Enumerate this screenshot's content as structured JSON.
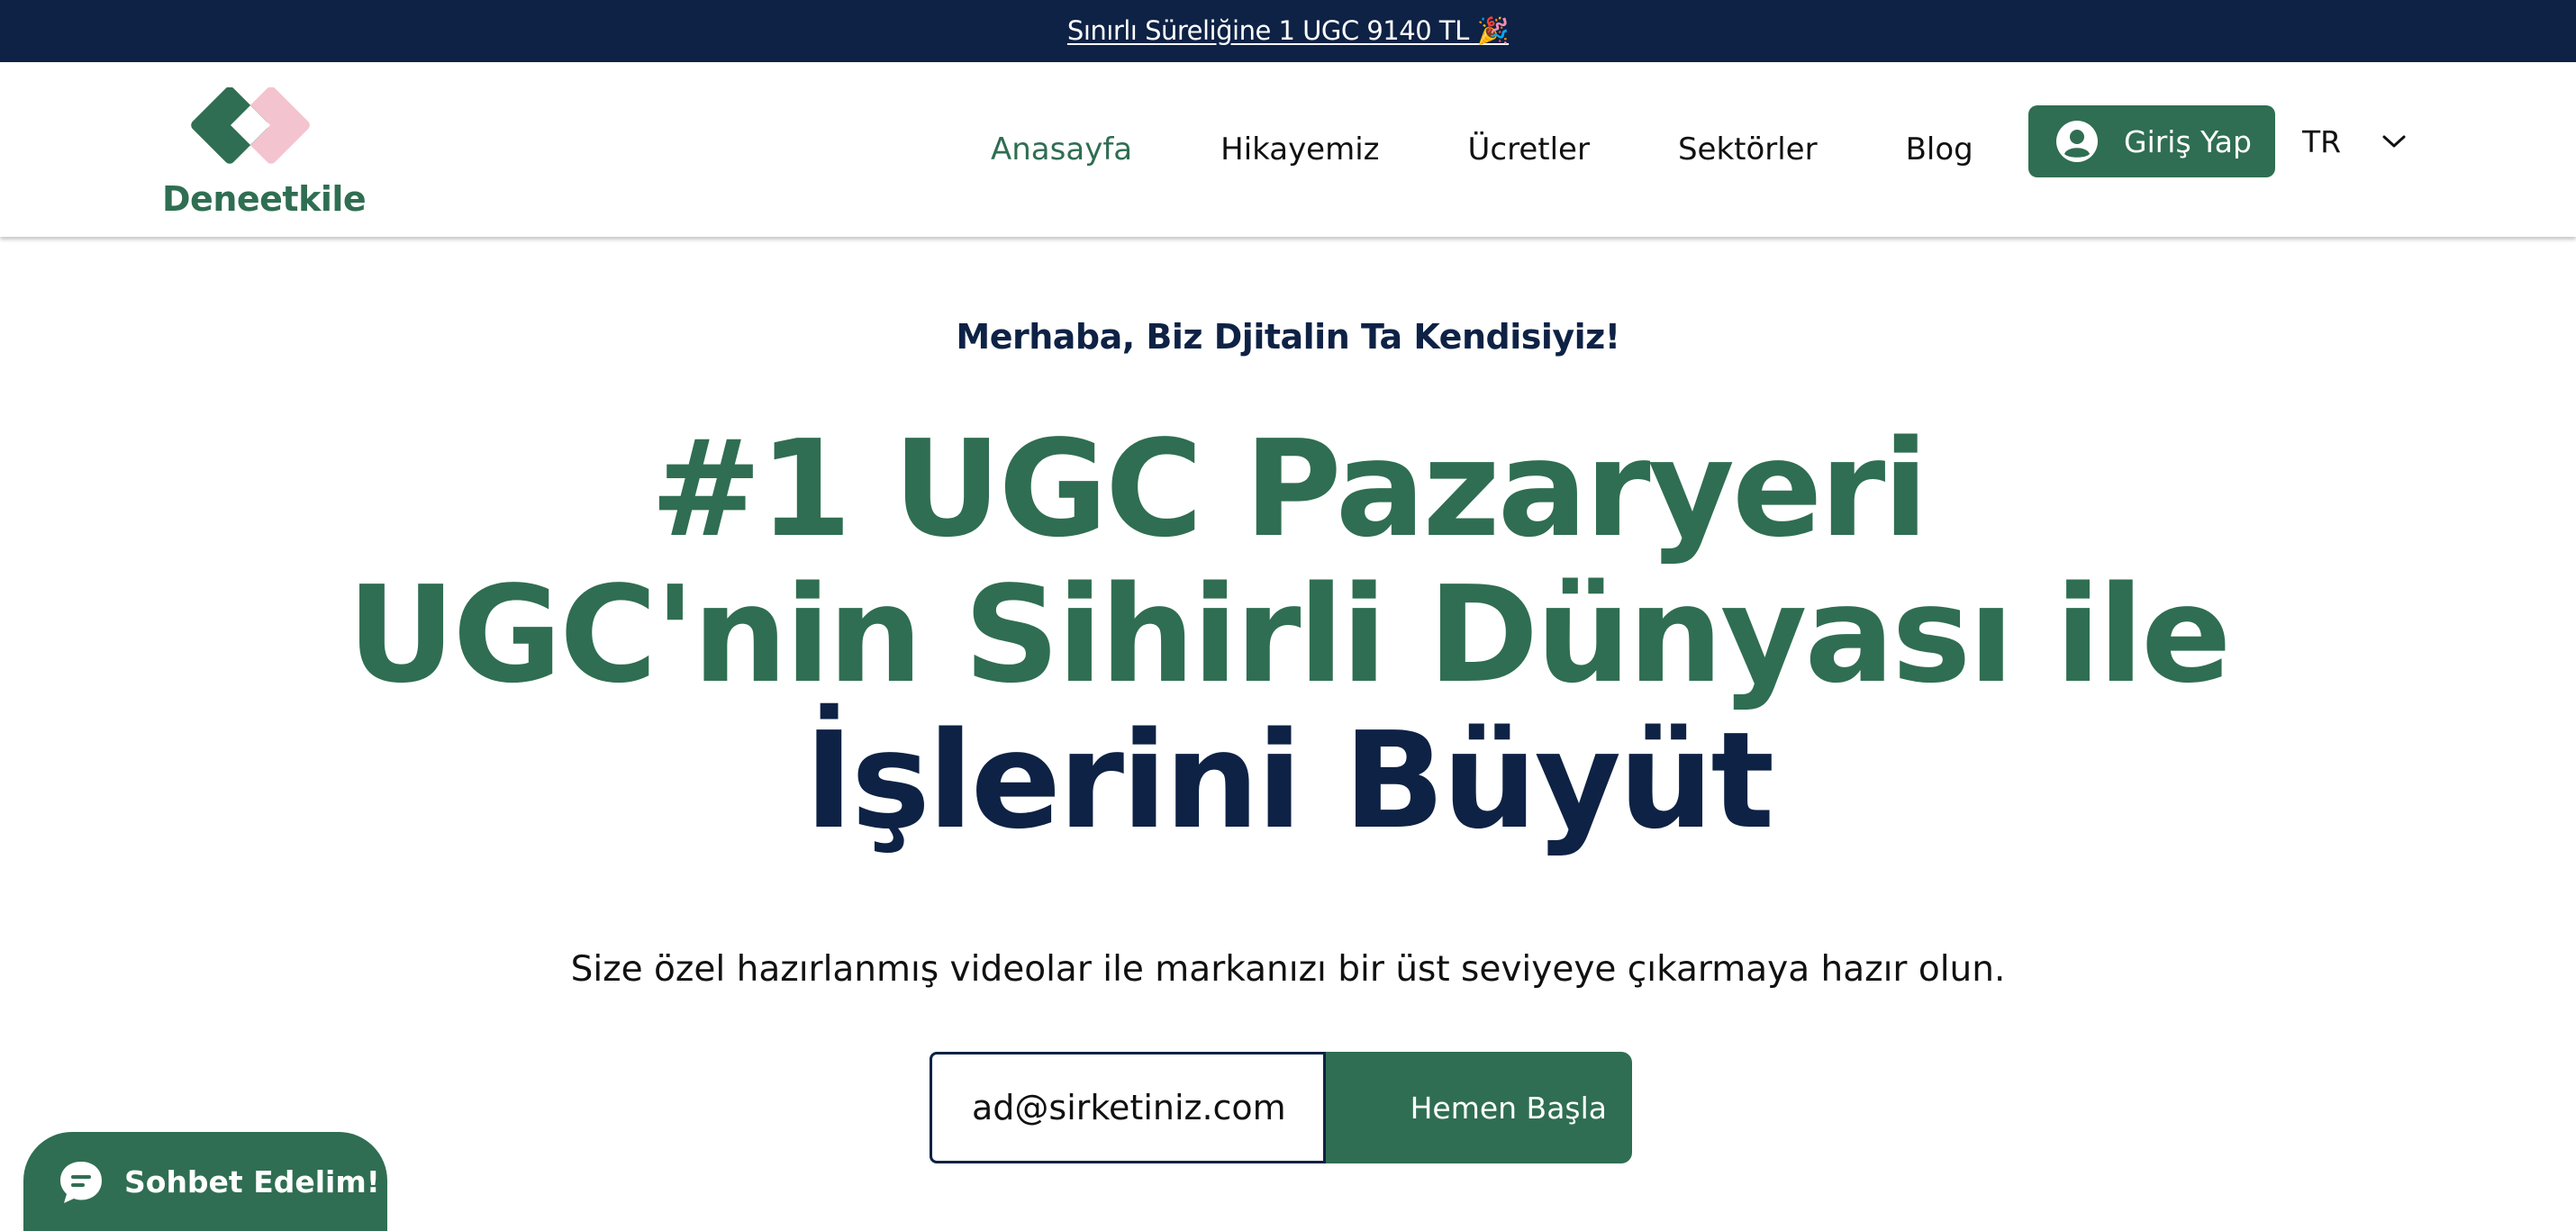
{
  "announcement": {
    "text": "Sınırlı Süreliğine 1 UGC 9140 TL  🎉"
  },
  "header": {
    "logo_text": "Deneetkile",
    "colors": {
      "brand_green": "#2f6e52",
      "brand_pink": "#f3c4cf",
      "navy": "#0e2245"
    },
    "nav": [
      {
        "label": "Anasayfa",
        "active": true
      },
      {
        "label": "Hikayemiz",
        "active": false
      },
      {
        "label": "Ücretler",
        "active": false
      },
      {
        "label": "Sektörler",
        "active": false
      },
      {
        "label": "Blog",
        "active": false
      }
    ],
    "login": {
      "label": "Giriş Yap",
      "icon": "user-avatar-icon"
    },
    "language": {
      "selected": "TR",
      "icon": "chevron-down-icon"
    }
  },
  "hero": {
    "greeting": "Merhaba, Biz Djitalin Ta Kendisiyiz!",
    "title_line1": "#1 UGC Pazaryeri",
    "title_line2": "UGC'nin Sihirli Dünyası ile",
    "title_line3": "İşlerini Büyüt",
    "subtitle": "Size özel hazırlanmış videolar ile markanızı bir üst seviyeye çıkarmaya hazır olun.",
    "email_placeholder": "ad@sirketiniz.com",
    "cta_label": "Hemen Başla"
  },
  "chat": {
    "label": "Sohbet Edelim!",
    "icon": "chat-bubble-icon"
  }
}
